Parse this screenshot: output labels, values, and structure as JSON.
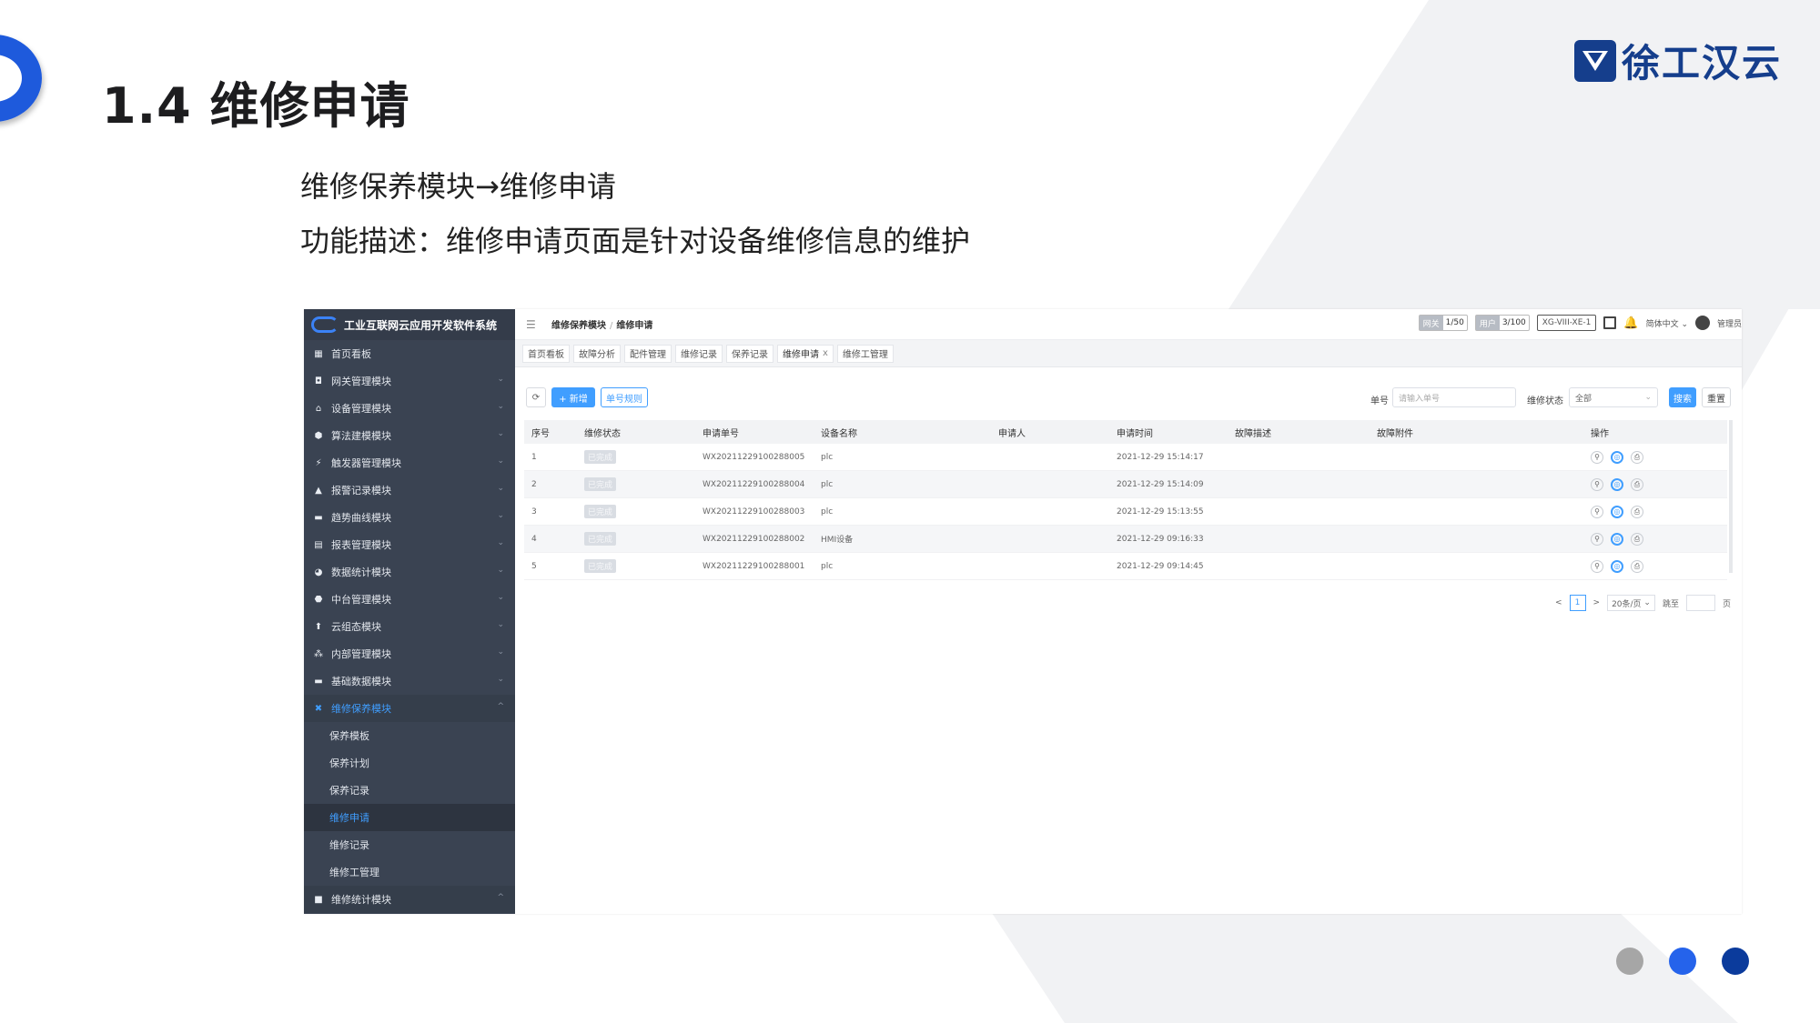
{
  "slide": {
    "title": "1.4 维修申请",
    "path_line": "维修保养模块→维修申请",
    "desc_line": "功能描述：维修申请页面是针对设备维修信息的维护",
    "brand_text": "徐工汉云",
    "colors": {
      "accent": "#1e5adc",
      "brand": "#153e8c",
      "dot1": "#a6a6a6",
      "dot2": "#2563eb",
      "dot3": "#0b3b9c"
    }
  },
  "app": {
    "system_title": "工业互联网云应用开发软件系统",
    "sidebar": {
      "items": [
        {
          "label": "首页看板",
          "icon": "dashboard-icon",
          "expandable": false
        },
        {
          "label": "网关管理模块",
          "icon": "gateway-icon",
          "expandable": true
        },
        {
          "label": "设备管理模块",
          "icon": "device-icon",
          "expandable": true
        },
        {
          "label": "算法建模模块",
          "icon": "gear-icon",
          "expandable": true
        },
        {
          "label": "触发器管理模块",
          "icon": "trigger-icon",
          "expandable": true
        },
        {
          "label": "报警记录模块",
          "icon": "alarm-icon",
          "expandable": true
        },
        {
          "label": "趋势曲线模块",
          "icon": "trend-icon",
          "expandable": true
        },
        {
          "label": "报表管理模块",
          "icon": "report-icon",
          "expandable": true
        },
        {
          "label": "数据统计模块",
          "icon": "pie-icon",
          "expandable": true
        },
        {
          "label": "中台管理模块",
          "icon": "hub-icon",
          "expandable": true
        },
        {
          "label": "云组态模块",
          "icon": "cloud-config-icon",
          "expandable": true
        },
        {
          "label": "内部管理模块",
          "icon": "org-icon",
          "expandable": true
        },
        {
          "label": "基础数据模块",
          "icon": "data-icon",
          "expandable": true
        }
      ],
      "active_group": {
        "label": "维修保养模块",
        "icon": "wrench-icon"
      },
      "sub_items": [
        "保养模板",
        "保养计划",
        "保养记录",
        "维修申请",
        "维修记录",
        "维修工管理"
      ],
      "active_sub": "维修申请",
      "last_group": {
        "label": "维修统计模块",
        "icon": "stats-icon"
      }
    },
    "breadcrumb": {
      "parent": "维修保养模块",
      "sep": "/",
      "current": "维修申请"
    },
    "topbar": {
      "gateway_key": "网关",
      "gateway_val": "1/50",
      "user_key": "用户",
      "user_val": "3/100",
      "model": "XG-VIII-XE-1",
      "language": "简体中文",
      "user_name": "管理员"
    },
    "tabs": [
      "首页看板",
      "故障分析",
      "配件管理",
      "维修记录",
      "保养记录",
      "维修申请",
      "维修工管理"
    ],
    "active_tab": "维修申请",
    "tab_close": "x",
    "toolbar": {
      "add_label": "+ 新增",
      "rule_label": "单号规则",
      "order_label": "单号",
      "order_placeholder": "请输入单号",
      "status_label": "维修状态",
      "status_value": "全部",
      "search_label": "搜索",
      "reset_label": "重置"
    },
    "table": {
      "columns": [
        "序号",
        "维修状态",
        "申请单号",
        "设备名称",
        "申请人",
        "申请时间",
        "故障描述",
        "故障附件",
        "操作"
      ],
      "rows": [
        {
          "no": "1",
          "status": "已完成",
          "order": "WX20211229100288005",
          "device": "plc",
          "applicant": "",
          "time": "2021-12-29 15:14:17",
          "desc": "",
          "attach": ""
        },
        {
          "no": "2",
          "status": "已完成",
          "order": "WX20211229100288004",
          "device": "plc",
          "applicant": "",
          "time": "2021-12-29 15:14:09",
          "desc": "",
          "attach": ""
        },
        {
          "no": "3",
          "status": "已完成",
          "order": "WX20211229100288003",
          "device": "plc",
          "applicant": "",
          "time": "2021-12-29 15:13:55",
          "desc": "",
          "attach": ""
        },
        {
          "no": "4",
          "status": "已完成",
          "order": "WX20211229100288002",
          "device": "HMI设备",
          "applicant": "",
          "time": "2021-12-29 09:16:33",
          "desc": "",
          "attach": ""
        },
        {
          "no": "5",
          "status": "已完成",
          "order": "WX20211229100288001",
          "device": "plc",
          "applicant": "",
          "time": "2021-12-29 09:14:45",
          "desc": "",
          "attach": ""
        }
      ]
    },
    "pager": {
      "prev": "<",
      "current": "1",
      "next": ">",
      "page_size": "20条/页",
      "jump_label": "跳至",
      "page_unit": "页"
    }
  }
}
